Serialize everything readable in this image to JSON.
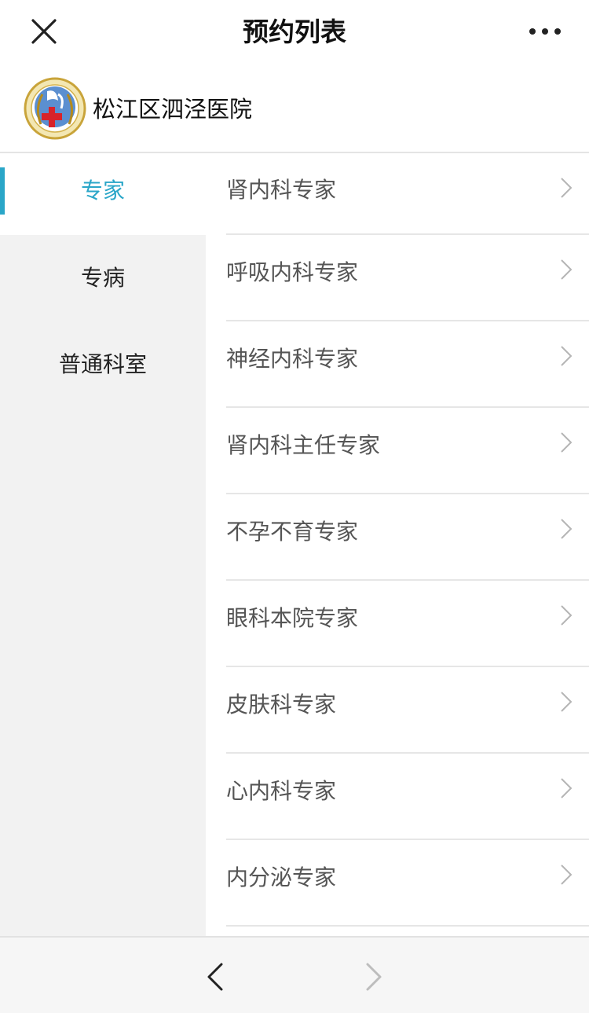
{
  "nav": {
    "title": "预约列表",
    "close_icon": "close-icon",
    "more_icon": "more-dots-icon"
  },
  "hospital": {
    "name": "松江区泗泾医院",
    "logo_icon": "hospital-logo-icon"
  },
  "sidebar": {
    "items": [
      {
        "label": "专家",
        "active": true
      },
      {
        "label": "专病",
        "active": false
      },
      {
        "label": "普通科室",
        "active": false
      }
    ]
  },
  "departments": [
    {
      "label": "肾内科专家"
    },
    {
      "label": "呼吸内科专家"
    },
    {
      "label": "神经内科专家"
    },
    {
      "label": "肾内科主任专家"
    },
    {
      "label": "不孕不育专家"
    },
    {
      "label": "眼科本院专家"
    },
    {
      "label": "皮肤科专家"
    },
    {
      "label": "心内科专家"
    },
    {
      "label": "内分泌专家"
    }
  ],
  "bottom_bar": {
    "back_icon": "chevron-left-icon",
    "forward_icon": "chevron-right-icon"
  },
  "colors": {
    "accent": "#2aa6c8",
    "sidebar_bg": "#f2f2f2",
    "divider": "#e6e6e6"
  }
}
